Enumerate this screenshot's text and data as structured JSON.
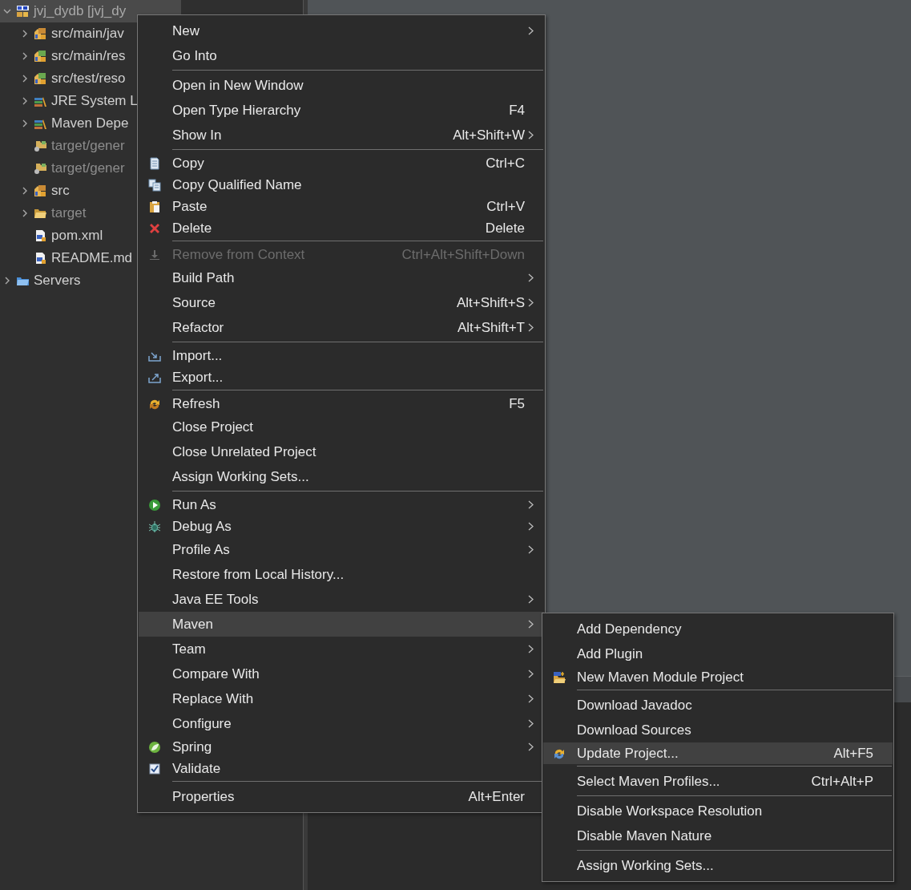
{
  "tree": [
    {
      "label": "jvj_dydb [jvj_dy",
      "kind": "project",
      "selected": true,
      "expanded": true,
      "dimmed": false,
      "children": [
        {
          "label": "src/main/jav",
          "kind": "source-folder",
          "selected": false,
          "expanded": false,
          "dimmed": false
        },
        {
          "label": "src/main/res",
          "kind": "resource-folder",
          "selected": false,
          "expanded": false,
          "dimmed": false
        },
        {
          "label": "src/test/reso",
          "kind": "resource-folder",
          "selected": false,
          "expanded": false,
          "dimmed": false
        },
        {
          "label": "JRE System L",
          "kind": "library",
          "selected": false,
          "expanded": false,
          "dimmed": false
        },
        {
          "label": "Maven Depe",
          "kind": "library",
          "selected": false,
          "expanded": false,
          "dimmed": false
        },
        {
          "label": "target/gener",
          "kind": "generated-folder",
          "selected": false,
          "dimmed": true
        },
        {
          "label": "target/gener",
          "kind": "generated-folder",
          "selected": false,
          "dimmed": true
        },
        {
          "label": "src",
          "kind": "source-folder",
          "selected": false,
          "expanded": false,
          "dimmed": false
        },
        {
          "label": "target",
          "kind": "folder",
          "selected": false,
          "expanded": false,
          "dimmed": true
        },
        {
          "label": "pom.xml",
          "kind": "file",
          "selected": false,
          "dimmed": false
        },
        {
          "label": "README.md",
          "kind": "file",
          "selected": false,
          "dimmed": false
        }
      ]
    },
    {
      "label": "Servers",
      "kind": "servers",
      "selected": false,
      "expanded": false,
      "dimmed": false
    }
  ],
  "context_menu": {
    "items": [
      {
        "kind": "item",
        "label": "New",
        "submenu": true,
        "selected": false,
        "disabled": false
      },
      {
        "kind": "item",
        "label": "Go Into",
        "submenu": false,
        "selected": false,
        "disabled": false
      },
      {
        "kind": "separator"
      },
      {
        "kind": "item",
        "label": "Open in New Window",
        "submenu": false,
        "selected": false,
        "disabled": false
      },
      {
        "kind": "item",
        "label": "Open Type Hierarchy",
        "shortcut": "F4",
        "submenu": false,
        "selected": false,
        "disabled": false
      },
      {
        "kind": "item",
        "label": "Show In",
        "shortcut": "Alt+Shift+W",
        "submenu": true,
        "selected": false,
        "disabled": false
      },
      {
        "kind": "separator"
      },
      {
        "kind": "item",
        "label": "Copy",
        "shortcut": "Ctrl+C",
        "submenu": false,
        "selected": false,
        "disabled": false
      },
      {
        "kind": "item",
        "label": "Copy Qualified Name",
        "submenu": false,
        "selected": false,
        "disabled": false
      },
      {
        "kind": "item",
        "label": "Paste",
        "shortcut": "Ctrl+V",
        "submenu": false,
        "selected": false,
        "disabled": false
      },
      {
        "kind": "item",
        "label": "Delete",
        "shortcut": "Delete",
        "submenu": false,
        "selected": false,
        "disabled": false
      },
      {
        "kind": "separator"
      },
      {
        "kind": "item",
        "label": "Remove from Context",
        "shortcut": "Ctrl+Alt+Shift+Down",
        "submenu": false,
        "selected": false,
        "disabled": true
      },
      {
        "kind": "item",
        "label": "Build Path",
        "submenu": true,
        "selected": false,
        "disabled": false
      },
      {
        "kind": "item",
        "label": "Source",
        "shortcut": "Alt+Shift+S",
        "submenu": true,
        "selected": false,
        "disabled": false
      },
      {
        "kind": "item",
        "label": "Refactor",
        "shortcut": "Alt+Shift+T",
        "submenu": true,
        "selected": false,
        "disabled": false
      },
      {
        "kind": "separator"
      },
      {
        "kind": "item",
        "label": "Import...",
        "submenu": false,
        "selected": false,
        "disabled": false
      },
      {
        "kind": "item",
        "label": "Export...",
        "submenu": false,
        "selected": false,
        "disabled": false
      },
      {
        "kind": "separator"
      },
      {
        "kind": "item",
        "label": "Refresh",
        "shortcut": "F5",
        "submenu": false,
        "selected": false,
        "disabled": false
      },
      {
        "kind": "item",
        "label": "Close Project",
        "submenu": false,
        "selected": false,
        "disabled": false
      },
      {
        "kind": "item",
        "label": "Close Unrelated Project",
        "submenu": false,
        "selected": false,
        "disabled": false
      },
      {
        "kind": "item",
        "label": "Assign Working Sets...",
        "submenu": false,
        "selected": false,
        "disabled": false
      },
      {
        "kind": "separator"
      },
      {
        "kind": "item",
        "label": "Run As",
        "submenu": true,
        "selected": false,
        "disabled": false
      },
      {
        "kind": "item",
        "label": "Debug As",
        "submenu": true,
        "selected": false,
        "disabled": false
      },
      {
        "kind": "item",
        "label": "Profile As",
        "submenu": true,
        "selected": false,
        "disabled": false
      },
      {
        "kind": "item",
        "label": "Restore from Local History...",
        "submenu": false,
        "selected": false,
        "disabled": false
      },
      {
        "kind": "item",
        "label": "Java EE Tools",
        "submenu": true,
        "selected": false,
        "disabled": false
      },
      {
        "kind": "item",
        "label": "Maven",
        "submenu": true,
        "selected": true,
        "disabled": false
      },
      {
        "kind": "item",
        "label": "Team",
        "submenu": true,
        "selected": false,
        "disabled": false
      },
      {
        "kind": "item",
        "label": "Compare With",
        "submenu": true,
        "selected": false,
        "disabled": false
      },
      {
        "kind": "item",
        "label": "Replace With",
        "submenu": true,
        "selected": false,
        "disabled": false
      },
      {
        "kind": "item",
        "label": "Configure",
        "submenu": true,
        "selected": false,
        "disabled": false
      },
      {
        "kind": "item",
        "label": "Spring",
        "submenu": true,
        "selected": false,
        "disabled": false
      },
      {
        "kind": "item",
        "label": "Validate",
        "submenu": false,
        "selected": false,
        "disabled": false
      },
      {
        "kind": "separator"
      },
      {
        "kind": "item",
        "label": "Properties",
        "shortcut": "Alt+Enter",
        "submenu": false,
        "selected": false,
        "disabled": false
      }
    ]
  },
  "submenu": {
    "items": [
      {
        "kind": "item",
        "label": "Add Dependency",
        "selected": false
      },
      {
        "kind": "item",
        "label": "Add Plugin",
        "selected": false
      },
      {
        "kind": "item",
        "label": "New Maven Module Project",
        "selected": false
      },
      {
        "kind": "separator"
      },
      {
        "kind": "item",
        "label": "Download Javadoc",
        "selected": false
      },
      {
        "kind": "item",
        "label": "Download Sources",
        "selected": false
      },
      {
        "kind": "item",
        "label": "Update Project...",
        "shortcut": "Alt+F5",
        "selected": true
      },
      {
        "kind": "separator"
      },
      {
        "kind": "item",
        "label": "Select Maven Profiles...",
        "shortcut": "Ctrl+Alt+P",
        "selected": false
      },
      {
        "kind": "separator"
      },
      {
        "kind": "item",
        "label": "Disable Workspace Resolution",
        "selected": false
      },
      {
        "kind": "item",
        "label": "Disable Maven Nature",
        "selected": false
      },
      {
        "kind": "separator"
      },
      {
        "kind": "item",
        "label": "Assign Working Sets...",
        "selected": false
      }
    ]
  }
}
